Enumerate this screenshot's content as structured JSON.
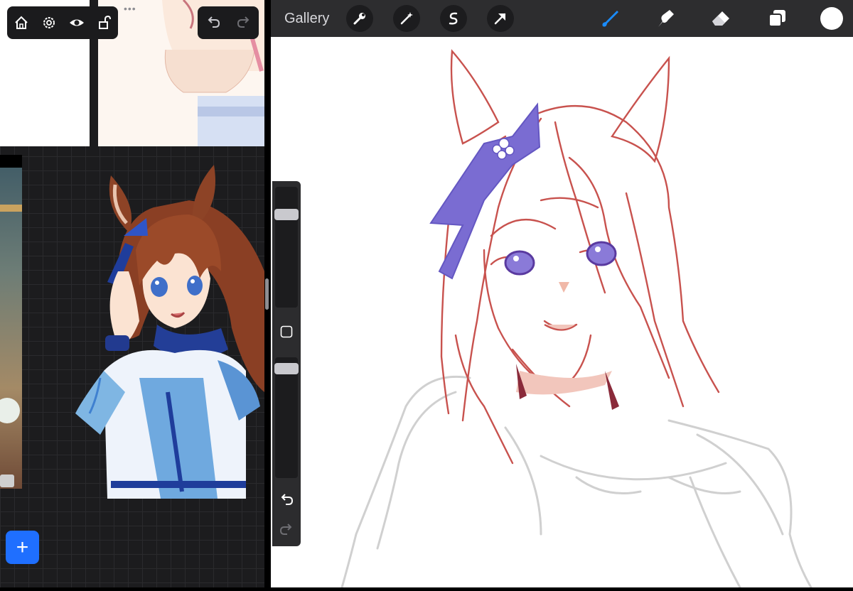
{
  "left_app": {
    "toolbar_icons": [
      "home-icon",
      "settings-gear-icon",
      "eye-icon",
      "unlock-icon"
    ],
    "more_dots": "•••",
    "undo_icon": "undo-icon",
    "redo_icon": "redo-icon",
    "add_button": "+"
  },
  "procreate": {
    "gallery_label": "Gallery",
    "left_tools": [
      "wrench-icon",
      "magic-wand-icon",
      "selection-s-icon",
      "transform-arrow-icon"
    ],
    "right_tools": [
      "brush-icon",
      "smudge-icon",
      "eraser-icon",
      "layers-icon"
    ],
    "accent_color": "#1a8cff",
    "current_color": "#ffffff",
    "side_undo": "undo-icon",
    "side_redo": "redo-icon",
    "brush_size_level": 0.8,
    "brush_opacity_level": 0.95
  }
}
